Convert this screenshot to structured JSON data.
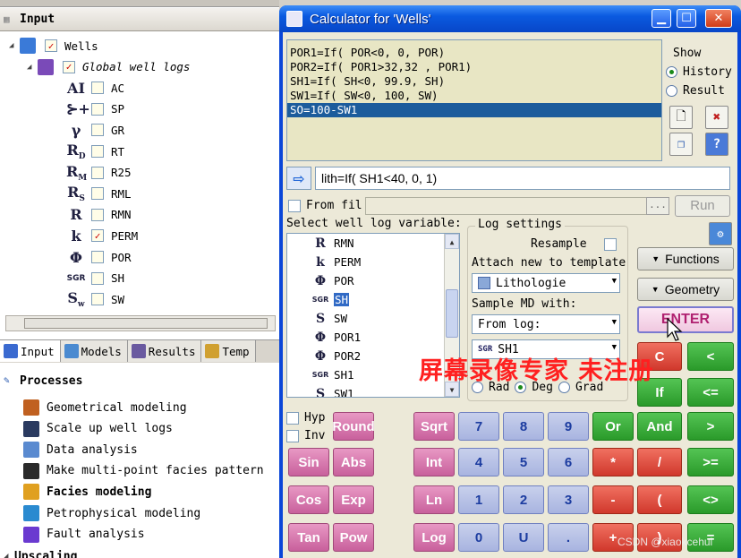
{
  "input_panel": {
    "title": "Input",
    "tree": [
      {
        "label": "Wells",
        "checked": true,
        "icon": "wells-icon"
      },
      {
        "label": "Global well logs",
        "checked": true,
        "icon": "well-logs-folder-icon"
      },
      {
        "label": "AC",
        "glyph": "AI",
        "checked": false
      },
      {
        "label": "SP",
        "glyph": "⊱+",
        "checked": false
      },
      {
        "label": "GR",
        "glyph": "γ",
        "checked": false
      },
      {
        "label": "RT",
        "glyph": "R",
        "sub": "D",
        "checked": false
      },
      {
        "label": "R25",
        "glyph": "R",
        "sub": "M",
        "checked": false
      },
      {
        "label": "RML",
        "glyph": "R",
        "sub": "S",
        "checked": false
      },
      {
        "label": "RMN",
        "glyph": "R",
        "checked": false
      },
      {
        "label": "PERM",
        "glyph": "k",
        "checked": true
      },
      {
        "label": "POR",
        "glyph": "Φ",
        "checked": false
      },
      {
        "label": "SH",
        "glyph": "SGR",
        "checked": false
      },
      {
        "label": "SW",
        "glyph": "S",
        "sub": "w",
        "checked": false
      }
    ]
  },
  "tabs": [
    {
      "label": "Input",
      "active": true
    },
    {
      "label": "Models",
      "active": false
    },
    {
      "label": "Results",
      "active": false
    },
    {
      "label": "Temp",
      "active": false
    }
  ],
  "processes": {
    "title": "Processes",
    "items": [
      {
        "label": "Geometrical modeling",
        "bold": false
      },
      {
        "label": "Scale up well logs",
        "bold": false
      },
      {
        "label": "Data analysis",
        "bold": false
      },
      {
        "label": "Make multi-point facies pattern",
        "bold": false
      },
      {
        "label": "Facies modeling",
        "bold": true
      },
      {
        "label": "Petrophysical modeling",
        "bold": false
      },
      {
        "label": "Fault analysis",
        "bold": false
      }
    ],
    "next_section": "Upscaling"
  },
  "calculator": {
    "title": "Calculator for 'Wells'",
    "history": [
      "POR1=If( POR<0, 0, POR)",
      "POR2=If( POR1>32,32 , POR1)",
      "SH1=If( SH<0, 99.9, SH)",
      "SW1=If( SW<0, 100, SW)",
      "SO=100-SW1"
    ],
    "history_selected_index": 4,
    "show": {
      "label": "Show",
      "options": [
        {
          "label": "History",
          "selected": true
        },
        {
          "label": "Result",
          "selected": false
        }
      ]
    },
    "expression": "lith=If( SH1<40, 0, 1)",
    "from_file_label": "From fil",
    "browse_label": "...",
    "run_label": "Run",
    "variable_list_label": "Select well log variable:",
    "variables": [
      {
        "label": "RMN",
        "glyph": "R"
      },
      {
        "label": "PERM",
        "glyph": "k"
      },
      {
        "label": "POR",
        "glyph": "Φ"
      },
      {
        "label": "SH",
        "glyph": "SGR",
        "selected": true
      },
      {
        "label": "SW",
        "glyph": "S"
      },
      {
        "label": "POR1",
        "glyph": "Φ"
      },
      {
        "label": "POR2",
        "glyph": "Φ"
      },
      {
        "label": "SH1",
        "glyph": "SGR"
      },
      {
        "label": "SW1",
        "glyph": "S"
      }
    ],
    "log_settings": {
      "title": "Log settings",
      "resample_label": "Resample",
      "attach_label": "Attach new to template",
      "template_value": "Lithologie",
      "sample_label": "Sample MD with:",
      "sample_value": "From log:",
      "log_value": "SH1",
      "angle_options": [
        {
          "label": "Rad",
          "selected": false
        },
        {
          "label": "Deg",
          "selected": true
        },
        {
          "label": "Grad",
          "selected": false
        }
      ]
    },
    "side_buttons": {
      "functions": "Functions",
      "geometry": "Geometry",
      "enter": "ENTER",
      "clear": "C",
      "back": "<",
      "if": "If",
      "le": "<="
    },
    "checkboxes": {
      "hyp": "Hyp",
      "inv": "Inv"
    },
    "keypad": [
      [
        "Round",
        "Sqrt",
        "7",
        "8",
        "9",
        "Or",
        "And",
        ">"
      ],
      [
        "Sin",
        "Abs",
        "Int",
        "4",
        "5",
        "6",
        "*",
        "/",
        ">="
      ],
      [
        "Cos",
        "Exp",
        "Ln",
        "1",
        "2",
        "3",
        "-",
        "(",
        "<>"
      ],
      [
        "Tan",
        "Pow",
        "Log",
        "0",
        "U",
        ".",
        "+",
        ")",
        "="
      ]
    ]
  },
  "overlay": {
    "watermark": "屏幕录像专家 未注册",
    "credit": "CSDN @xiaokcehui"
  }
}
